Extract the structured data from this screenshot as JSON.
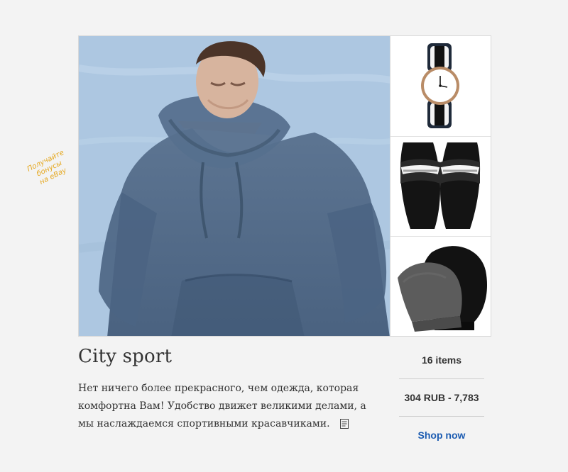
{
  "promo": {
    "lines": [
      "Получайте",
      "бонусы",
      "на eBay"
    ]
  },
  "collection": {
    "title": "City sport",
    "description": "Нет ничего более прекрасного, чем одежда, которая комфортна Вам! Удобство движет великими делами, а мы наслаждаемся спортивными красавчиками.",
    "items_label": "16 items",
    "price_range": "304 RUB - 7,783",
    "shop_label": "Shop now"
  },
  "images": {
    "hero": "hoodie-model",
    "thumbs": [
      "watch",
      "supreme-slides",
      "beanies"
    ]
  },
  "colors": {
    "link": "#1b5bb1",
    "promo": "#e5a71d"
  }
}
